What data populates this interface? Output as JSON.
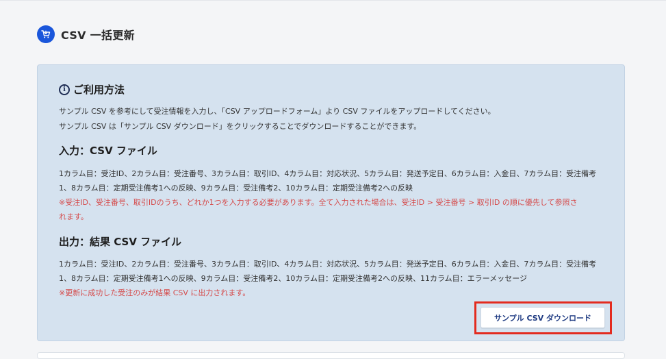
{
  "header": {
    "title": "CSV 一括更新",
    "icon": "cart-refresh-icon",
    "icon_color": "#1a56db"
  },
  "howto": {
    "title": "ご利用方法",
    "icon": "info-icon",
    "lines": [
      "サンプル CSV を参考にして受注情報を入力し、「CSV アップロードフォーム」より CSV ファイルをアップロードしてください。",
      "サンプル CSV は「サンプル CSV ダウンロード」をクリックすることでダウンロードすることができます。"
    ]
  },
  "input_section": {
    "title": "入力：CSV ファイル",
    "lines": [
      "1カラム目：受注ID、2カラム目：受注番号、3カラム目：取引ID、4カラム目：対応状況、5カラム目：発送予定日、6カラム目：入金日、7カラム目：受注備考",
      "1、8カラム目：定期受注備考1への反映、9カラム目：受注備考2、10カラム目：定期受注備考2への反映"
    ],
    "notes": [
      "※受注ID、受注番号、取引IDのうち、どれか1つを入力する必要があります。全て入力された場合は、受注ID > 受注番号 > 取引ID の順に優先して参照さ",
      "れます。"
    ]
  },
  "output_section": {
    "title": "出力：結果 CSV ファイル",
    "lines": [
      "1カラム目：受注ID、2カラム目：受注番号、3カラム目：取引ID、4カラム目：対応状況、5カラム目：発送予定日、6カラム目：入金日、7カラム目：受注備考",
      "1、8カラム目：定期受注備考1への反映、9カラム目：受注備考2、10カラム目：定期受注備考2への反映、11カラム目：エラーメッセージ"
    ],
    "note": "※更新に成功した受注のみが結果 CSV に出力されます。"
  },
  "download_button": {
    "label": "サンプル CSV ダウンロード"
  },
  "colors": {
    "panel_bg": "#d5e2ef",
    "note_red": "#d54a4a",
    "highlight_red": "#e32b1f",
    "button_text": "#1f3b82"
  }
}
